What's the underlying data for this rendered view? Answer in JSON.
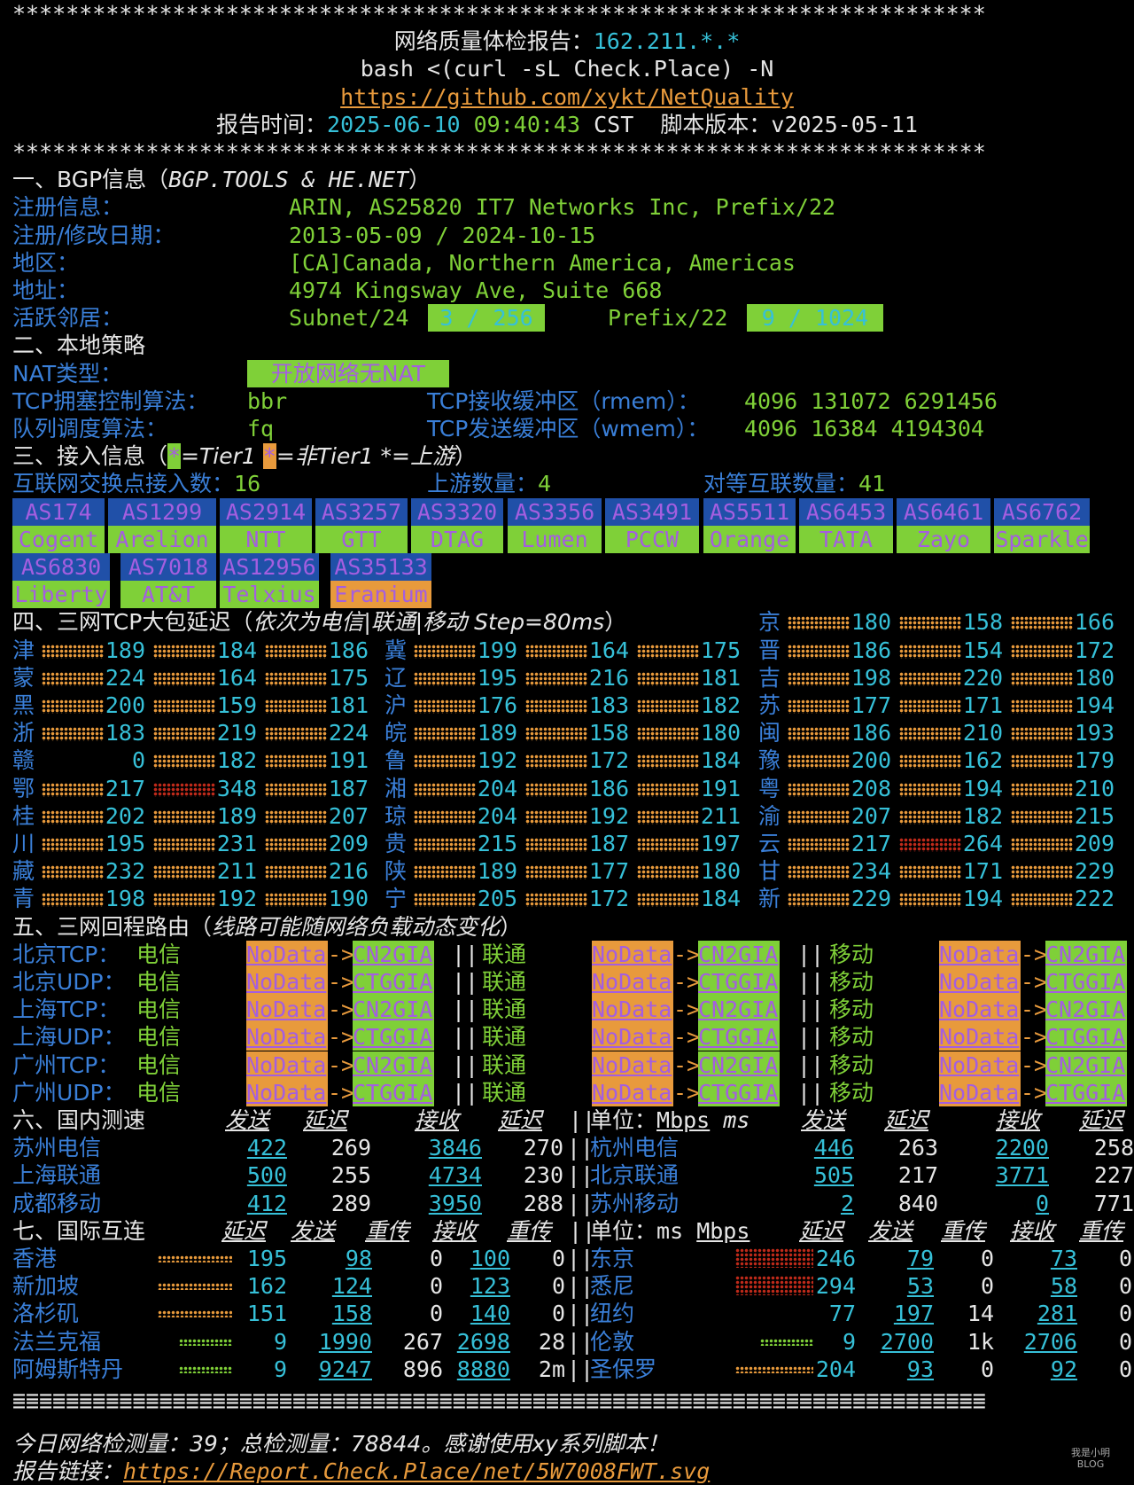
{
  "header": {
    "stars": "*************************************************************************",
    "title": "网络质量体检报告：",
    "ip": "162.211.*.*",
    "cmd": "bash <(curl -sL Check.Place) -N",
    "url": "https://github.com/xykt/NetQuality",
    "time_label": "报告时间：",
    "date": "2025-06-10",
    "clock": "09:40:43",
    "tz": "CST",
    "ver_label": "脚本版本：",
    "version": "v2025-05-11"
  },
  "bgp": {
    "title": "一、BGP信息（",
    "source": "BGP.TOOLS & HE.NET",
    "close": "）",
    "reg_label": "注册信息：",
    "reg_value": "ARIN, AS25820 IT7 Networks Inc, Prefix/22",
    "date_label": "注册/修改日期：",
    "date_value": "2013-05-09 / 2024-10-15",
    "geo_label": "地区：",
    "geo_value": "[CA]Canada, Northern America, Americas",
    "addr_label": "地址：",
    "addr_value": "4974 Kingsway Ave, Suite 668",
    "nb_label": "活跃邻居：",
    "subnet_label": "Subnet/24",
    "subnet_value": "3 / 256",
    "prefix_label": "Prefix/22",
    "prefix_value": "9 / 1024"
  },
  "policy": {
    "title": "二、本地策略",
    "nat_label": "NAT类型：",
    "nat_value": "开放网络无NAT",
    "cc_label": "TCP拥塞控制算法：",
    "cc_value": "bbr",
    "rmem_label": "TCP接收缓冲区（rmem）：",
    "rmem_value": "4096 131072 6291456",
    "qd_label": "队列调度算法：",
    "qd_value": "fq",
    "wmem_label": "TCP发送缓冲区（wmem）：",
    "wmem_value": "4096 16384 4194304"
  },
  "access": {
    "title": "三、接入信息（",
    "legend1": "=Tier1 ",
    "legend2": "=非Tier1 ",
    "legend3": "*=上游",
    "close": "）",
    "ix_label": "互联网交换点接入数：",
    "ix_value": "16",
    "up_label": "上游数量：",
    "up_value": "4",
    "peer_label": "对等互联数量：",
    "peer_value": "41",
    "row1": [
      {
        "as": "AS174",
        "name": "Cogent"
      },
      {
        "as": "AS1299",
        "name": "Arelion"
      },
      {
        "as": "AS2914",
        "name": "NTT"
      },
      {
        "as": "AS3257",
        "name": "GTT"
      },
      {
        "as": "AS3320",
        "name": "DTAG"
      },
      {
        "as": "AS3356",
        "name": "Lumen"
      },
      {
        "as": "AS3491",
        "name": "PCCW"
      },
      {
        "as": "AS5511",
        "name": "Orange"
      },
      {
        "as": "AS6453",
        "name": "TATA"
      },
      {
        "as": "AS6461",
        "name": "Zayo"
      },
      {
        "as": "AS6762",
        "name": "Sparkle"
      }
    ],
    "row2": [
      {
        "as": "AS6830",
        "name": "Liberty"
      },
      {
        "as": "AS7018",
        "name": "AT&T"
      },
      {
        "as": "AS12956",
        "name": "Telxius"
      },
      {
        "as": "AS35133",
        "name": "Eranium"
      }
    ]
  },
  "latency": {
    "title": "四、三网TCP大包延迟（",
    "note": "依次为电信|联通|移动 Step=80ms",
    "close": "）",
    "provinces": [
      {
        "p": "京",
        "v": [
          "180",
          "158",
          "166"
        ]
      },
      {
        "p": "津",
        "v": [
          "189",
          "184",
          "186"
        ]
      },
      {
        "p": "冀",
        "v": [
          "199",
          "164",
          "175"
        ]
      },
      {
        "p": "晋",
        "v": [
          "186",
          "154",
          "172"
        ]
      },
      {
        "p": "蒙",
        "v": [
          "224",
          "164",
          "175"
        ]
      },
      {
        "p": "辽",
        "v": [
          "195",
          "216",
          "181"
        ]
      },
      {
        "p": "吉",
        "v": [
          "198",
          "220",
          "180"
        ]
      },
      {
        "p": "黑",
        "v": [
          "200",
          "159",
          "181"
        ]
      },
      {
        "p": "沪",
        "v": [
          "176",
          "183",
          "182"
        ]
      },
      {
        "p": "苏",
        "v": [
          "177",
          "171",
          "194"
        ]
      },
      {
        "p": "浙",
        "v": [
          "183",
          "219",
          "224"
        ]
      },
      {
        "p": "皖",
        "v": [
          "189",
          "158",
          "180"
        ]
      },
      {
        "p": "闽",
        "v": [
          "186",
          "210",
          "193"
        ]
      },
      {
        "p": "赣",
        "v": [
          "0",
          "182",
          "191"
        ]
      },
      {
        "p": "鲁",
        "v": [
          "192",
          "172",
          "184"
        ]
      },
      {
        "p": "豫",
        "v": [
          "200",
          "162",
          "179"
        ]
      },
      {
        "p": "鄂",
        "v": [
          "217",
          "348",
          "187"
        ]
      },
      {
        "p": "湘",
        "v": [
          "204",
          "186",
          "191"
        ]
      },
      {
        "p": "粤",
        "v": [
          "208",
          "194",
          "210"
        ]
      },
      {
        "p": "桂",
        "v": [
          "202",
          "189",
          "207"
        ]
      },
      {
        "p": "琼",
        "v": [
          "204",
          "192",
          "211"
        ]
      },
      {
        "p": "渝",
        "v": [
          "207",
          "182",
          "215"
        ]
      },
      {
        "p": "川",
        "v": [
          "195",
          "231",
          "209"
        ]
      },
      {
        "p": "贵",
        "v": [
          "215",
          "187",
          "197"
        ]
      },
      {
        "p": "云",
        "v": [
          "217",
          "264",
          "209"
        ]
      },
      {
        "p": "藏",
        "v": [
          "232",
          "211",
          "216"
        ]
      },
      {
        "p": "陕",
        "v": [
          "189",
          "177",
          "180"
        ]
      },
      {
        "p": "甘",
        "v": [
          "234",
          "171",
          "229"
        ]
      },
      {
        "p": "青",
        "v": [
          "198",
          "192",
          "190"
        ]
      },
      {
        "p": "宁",
        "v": [
          "205",
          "172",
          "184"
        ]
      },
      {
        "p": "新",
        "v": [
          "229",
          "194",
          "222"
        ]
      }
    ]
  },
  "route": {
    "title": "五、三网回程路由（",
    "note": "线路可能随网络负载动态变化",
    "close": "）",
    "isp": [
      "电信",
      "联通",
      "移动"
    ],
    "nodata": "NoData",
    "arrow": "->",
    "sep": "||",
    "rows": [
      {
        "label": "北京TCP：",
        "dest": "CN2GIA"
      },
      {
        "label": "北京UDP：",
        "dest": "CTGGIA"
      },
      {
        "label": "上海TCP：",
        "dest": "CN2GIA"
      },
      {
        "label": "上海UDP：",
        "dest": "CTGGIA"
      },
      {
        "label": "广州TCP：",
        "dest": "CN2GIA"
      },
      {
        "label": "广州UDP：",
        "dest": "CTGGIA"
      }
    ]
  },
  "domestic": {
    "title": "六、国内测速",
    "h_send": "发送",
    "h_lat": "延迟",
    "h_recv": "接收",
    "unit_label": "单位：",
    "mbps": "Mbps",
    "ms": "ms",
    "rows": [
      {
        "l": {
          "n": "苏州电信",
          "s": "422",
          "d": "269",
          "r": "3846",
          "e": "270"
        },
        "r": {
          "n": "杭州电信",
          "s": "446",
          "d": "263",
          "r": "2200",
          "e": "258"
        }
      },
      {
        "l": {
          "n": "上海联通",
          "s": "500",
          "d": "255",
          "r": "4734",
          "e": "230"
        },
        "r": {
          "n": "北京联通",
          "s": "505",
          "d": "217",
          "r": "3771",
          "e": "227"
        }
      },
      {
        "l": {
          "n": "成都移动",
          "s": "412",
          "d": "289",
          "r": "3950",
          "e": "288"
        },
        "r": {
          "n": "苏州移动",
          "s": "2",
          "d": "840",
          "r": "0",
          "e": "771"
        }
      }
    ]
  },
  "intl": {
    "title": "七、国际互连",
    "h_lat": "延迟",
    "h_send": "发送",
    "h_rt": "重传",
    "h_recv": "接收",
    "unit_label": "单位：",
    "ms": "ms",
    "mbps": "Mbps",
    "rows": [
      {
        "l": {
          "n": "香港",
          "lat": "195",
          "s": "98",
          "rt1": "0",
          "r": "100",
          "rt2": "0"
        },
        "r": {
          "n": "东京",
          "lat": "246",
          "s": "79",
          "rt1": "0",
          "r": "73",
          "rt2": "0"
        }
      },
      {
        "l": {
          "n": "新加坡",
          "lat": "162",
          "s": "124",
          "rt1": "0",
          "r": "123",
          "rt2": "0"
        },
        "r": {
          "n": "悉尼",
          "lat": "294",
          "s": "53",
          "rt1": "0",
          "r": "58",
          "rt2": "0"
        }
      },
      {
        "l": {
          "n": "洛杉矶",
          "lat": "151",
          "s": "158",
          "rt1": "0",
          "r": "140",
          "rt2": "0"
        },
        "r": {
          "n": "纽约",
          "lat": "77",
          "s": "197",
          "rt1": "14",
          "r": "281",
          "rt2": "0"
        }
      },
      {
        "l": {
          "n": "法兰克福",
          "lat": "9",
          "s": "1990",
          "rt1": "267",
          "r": "2698",
          "rt2": "28"
        },
        "r": {
          "n": "伦敦",
          "lat": "9",
          "s": "2700",
          "rt1": "1k",
          "r": "2706",
          "rt2": "0"
        }
      },
      {
        "l": {
          "n": "阿姆斯特丹",
          "lat": "9",
          "s": "9247",
          "rt1": "896",
          "r": "8880",
          "rt2": "2m"
        },
        "r": {
          "n": "圣保罗",
          "lat": "204",
          "s": "93",
          "rt1": "0",
          "r": "92",
          "rt2": "0"
        }
      }
    ]
  },
  "footer": {
    "rule": "=========================================================================",
    "stats": "今日网络检测量：39；总检测量：78844。感谢使用xy系列脚本！",
    "link_label": "报告链接：",
    "link": "https://Report.Check.Place/net/5W7008FWT.svg",
    "watermark": "我是小明\nBLOG"
  },
  "colors": {
    "cyan": "#36c0d8",
    "blue": "#3a7fd8",
    "green": "#7fd038",
    "yellow": "#e8c640",
    "orange": "#e89a3c",
    "red": "#d83a2a",
    "purple": "#a45ee0",
    "white": "#e6e6e6"
  }
}
